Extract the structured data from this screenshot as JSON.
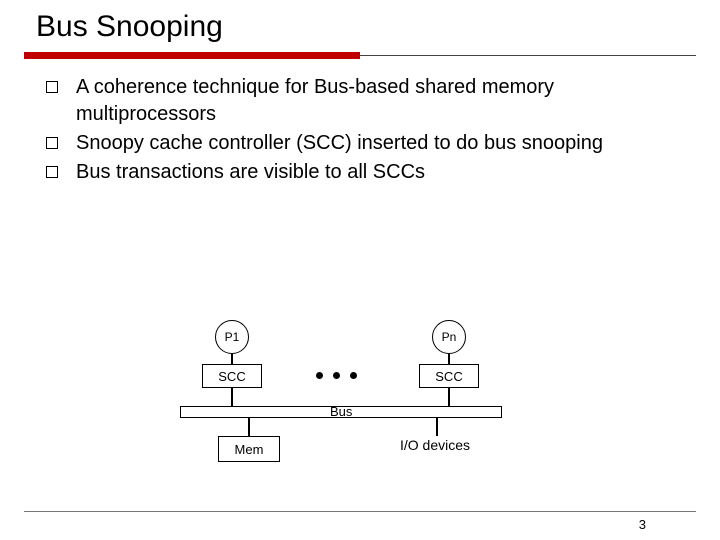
{
  "title": "Bus Snooping",
  "bullets": [
    "A coherence technique for Bus-based shared memory multiprocessors",
    "Snoopy cache controller (SCC) inserted to do bus snooping",
    "Bus transactions are visible to all SCCs"
  ],
  "diagram": {
    "proc_left": "P1",
    "proc_right": "Pn",
    "scc_left": "SCC",
    "scc_right": "SCC",
    "bus_label": "Bus",
    "mem_label": "Mem",
    "io_label": "I/O devices"
  },
  "page_number": "3"
}
